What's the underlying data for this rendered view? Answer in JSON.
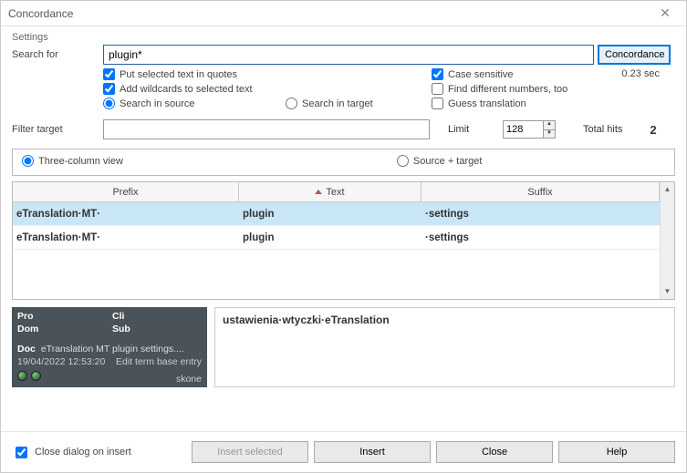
{
  "title": "Concordance",
  "settings_label": "Settings",
  "search": {
    "label": "Search for",
    "value": "plugin*",
    "button": "Concordance",
    "put_quotes": "Put selected text in quotes",
    "add_wildcards": "Add wildcards to selected text",
    "search_source": "Search in source",
    "search_target": "Search in target",
    "case_sensitive": "Case sensitive",
    "find_diff_numbers": "Find different numbers, too",
    "guess_translation": "Guess translation",
    "elapsed": "0.23 sec"
  },
  "filter": {
    "label": "Filter target",
    "value": "",
    "limit_label": "Limit",
    "limit_value": "128",
    "total_label": "Total hits",
    "total_value": "2"
  },
  "view": {
    "three_col": "Three-column view",
    "src_tgt": "Source + target"
  },
  "table": {
    "h_prefix": "Prefix",
    "h_text": "Text",
    "h_suffix": "Suffix",
    "rows": [
      {
        "prefix": "eTranslation·MT·",
        "text": "plugin",
        "suffix": "·settings"
      },
      {
        "prefix": "eTranslation·MT·",
        "text": "plugin",
        "suffix": "·settings"
      }
    ]
  },
  "meta": {
    "pro": "Pro",
    "cli": "Cli",
    "dom": "Dom",
    "sub": "Sub",
    "doc_label": "Doc",
    "doc_val": "eTranslation MT plugin settings....",
    "date": "19/04/2022 12:53:20",
    "action": "Edit term base entry",
    "user": "skone"
  },
  "translation": "ustawienia·wtyczki·eTranslation",
  "footer": {
    "close_on_insert": "Close dialog on insert",
    "insert_selected": "Insert selected",
    "insert": "Insert",
    "close": "Close",
    "help": "Help"
  }
}
